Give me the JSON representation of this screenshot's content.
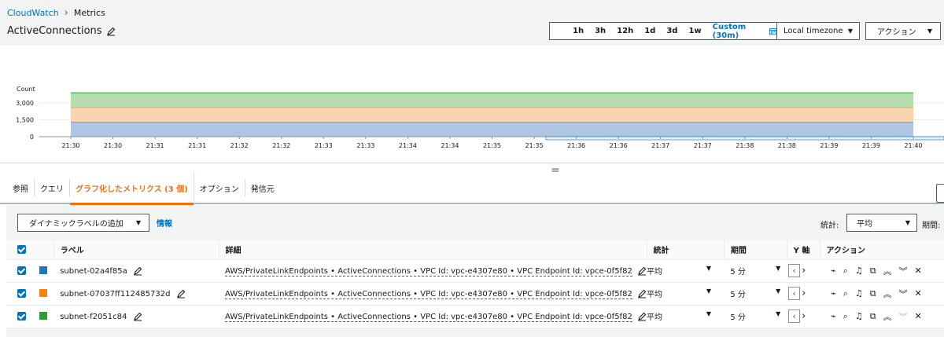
{
  "breadcrumb": {
    "root": "CloudWatch",
    "current": "Metrics"
  },
  "title": "ActiveConnections",
  "time_range": {
    "options": [
      "1h",
      "3h",
      "12h",
      "1d",
      "3d",
      "1w"
    ],
    "custom": "Custom (30m)",
    "timezone": "Local timezone",
    "actions": "アクション"
  },
  "chart_data": {
    "type": "area",
    "ylabel": "Count",
    "y_ticks": [
      "3,000",
      "1,500",
      "0"
    ],
    "x_ticks": [
      "21:30",
      "21:30",
      "21:31",
      "21:31",
      "21:32",
      "21:32",
      "21:33",
      "21:33",
      "21:34",
      "21:34",
      "21:35",
      "21:35",
      "21:36",
      "21:36",
      "21:37",
      "21:37",
      "21:38",
      "21:38",
      "21:39",
      "21:39",
      "21:40"
    ],
    "ylim": [
      0,
      3000
    ],
    "stacked": true,
    "series": [
      {
        "name": "subnet-02a4f85a",
        "color": "#aec6e4",
        "line": "#1f77b4",
        "value": 1300
      },
      {
        "name": "subnet-07037ff112485732d",
        "color": "#fbd3b1",
        "line": "#ff7f0e",
        "value": 1300
      },
      {
        "name": "subnet-f2051c84",
        "color": "#b5deb0",
        "line": "#2ca02c",
        "value": 1300
      }
    ]
  },
  "tabs": [
    "参照",
    "クエリ",
    "グラフ化したメトリクス (3 個)",
    "オプション",
    "発信元"
  ],
  "toolbar": {
    "dynamic_label": "ダイナミックラベルの追加",
    "info": "情報",
    "stat_label": "統計:",
    "stat_value": "平均",
    "period_label": "期間:"
  },
  "table": {
    "headers": {
      "label": "ラベル",
      "details": "詳細",
      "stat": "統計",
      "period": "期間",
      "yaxis": "Y 軸",
      "actions": "アクション"
    },
    "rows": [
      {
        "label": "subnet-02a4f85a",
        "color": "#1f77b4",
        "details": "AWS/PrivateLinkEndpoints • ActiveConnections • VPC Id: vpc-e4307e80 • VPC Endpoint Id: vpce-0f5f82",
        "stat": "平均",
        "period": "5 分"
      },
      {
        "label": "subnet-07037ff112485732d",
        "color": "#ff7f0e",
        "details": "AWS/PrivateLinkEndpoints • ActiveConnections • VPC Id: vpc-e4307e80 • VPC Endpoint Id: vpce-0f5f82",
        "stat": "平均",
        "period": "5 分"
      },
      {
        "label": "subnet-f2051c84",
        "color": "#2ca02c",
        "details": "AWS/PrivateLinkEndpoints • ActiveConnections • VPC Id: vpc-e4307e80 • VPC Endpoint Id: vpce-0f5f82",
        "stat": "平均",
        "period": "5 分"
      }
    ]
  }
}
